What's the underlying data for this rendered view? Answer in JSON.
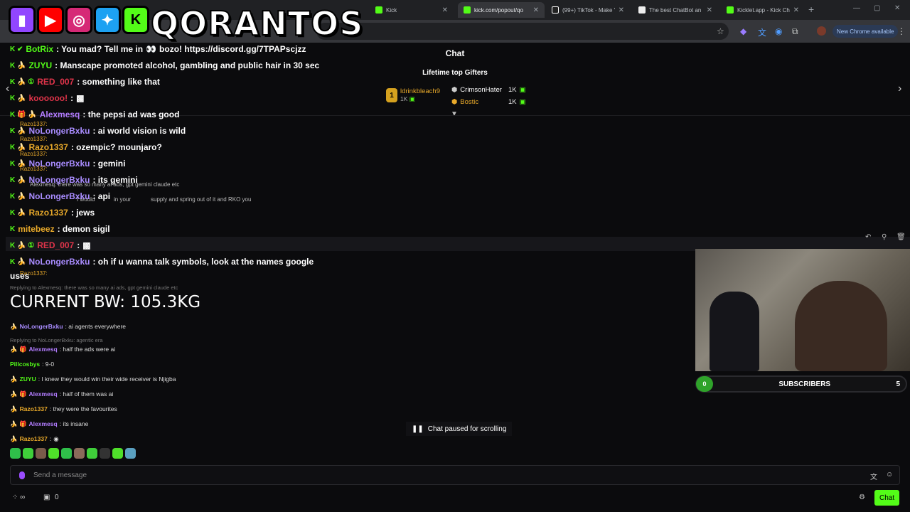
{
  "browser": {
    "tabs": [
      {
        "title": "Kick",
        "fav": "#53fc18"
      },
      {
        "title": "kick.com/popout/qo",
        "fav": "#53fc18",
        "active": true
      },
      {
        "title": "(99+) TikTok - Make Y",
        "fav": "#ffffff"
      },
      {
        "title": "The best ChatBot an",
        "fav": "#eeeeee"
      },
      {
        "title": "Kicklet.app - Kick Ch",
        "fav": "#53fc18"
      }
    ],
    "new_chrome": "New Chrome available"
  },
  "overlay": {
    "brand": "QORANTOS",
    "current_bw": "CURRENT BW: 105.3KG"
  },
  "chat": {
    "header": "Chat",
    "gifters_title": "Lifetime top Gifters",
    "gifters": [
      {
        "rank": "1",
        "name": "ldrinkbleach9",
        "amount": "1K",
        "color": "#e8a92a"
      },
      {
        "name": "CrimsonHater",
        "amount": "1K",
        "color": "#ffffff"
      },
      {
        "name": "Bostic",
        "amount": "1K",
        "color": "#e8a92a"
      }
    ],
    "big_messages": [
      {
        "user": "BotRix",
        "color": "#53fc18",
        "text": ": You mad? Tell me in ",
        "text2": " bozo! https://discord.gg/7TPAPscjzz"
      },
      {
        "user": "ZUYU",
        "color": "#53fc18",
        "text": ": Manscape promoted alcohol, gambling and public hair in 30 sec"
      },
      {
        "user": "RED_007",
        "color": "#e0344a",
        "text": ": something like that"
      },
      {
        "user": "koooooo!",
        "color": "#e0344a",
        "text": ":"
      },
      {
        "user": "Alexmesq",
        "color": "#b27cff",
        "text": ": the pepsi ad was good"
      },
      {
        "user": "NoLongerBxku",
        "color": "#a98cff",
        "text": ": ai world vision is wild"
      },
      {
        "user": "Razo1337",
        "color": "#e8a92a",
        "text": ": ozempic? mounjaro?"
      },
      {
        "user": "NoLongerBxku",
        "color": "#a98cff",
        "text": ": gemini"
      },
      {
        "user": "NoLongerBxku",
        "color": "#a98cff",
        "text": ": its gemini"
      },
      {
        "user": "NoLongerBxku",
        "color": "#a98cff",
        "text": ": api"
      },
      {
        "user": "Razo1337",
        "color": "#e8a92a",
        "text": ": jews"
      },
      {
        "user": "mitebeez",
        "color": "#e8a92a",
        "text": ": demon sigil"
      },
      {
        "user": "RED_007",
        "color": "#e0344a",
        "text": ":"
      },
      {
        "user": "NoLongerBxku",
        "color": "#a98cff",
        "text": ": oh if u wanna talk symbols, look at the names google"
      },
      {
        "user": "",
        "color": "#ffffff",
        "text": "uses"
      }
    ],
    "ghost_lines": {
      "g1": "Razo1337:",
      "g2": "Razo1337:",
      "g3": "Razo1337:",
      "g4": "Razo1337:",
      "g5": "Alexmesq: there was so many ai ads, gpt gemini claude etc",
      "g6": "I would",
      "g7": "in your",
      "g8": "supply and spring out of it and RKO you",
      "g9": "Razo1337:"
    },
    "small_messages": [
      {
        "user": "NoLongerBxku",
        "color": "#a98cff",
        "text": ": ai agents everywhere"
      },
      {
        "user": "Alexmesq",
        "color": "#b27cff",
        "text": ": half the ads were ai"
      },
      {
        "user": "Pillcosbys",
        "color": "#53fc18",
        "text": ": 9-0"
      },
      {
        "user": "ZUYU",
        "color": "#53fc18",
        "text": ": I knew they would win their wide receiver is Njigba"
      },
      {
        "user": "Alexmesq",
        "color": "#b27cff",
        "text": ": half of them was ai"
      },
      {
        "user": "Razo1337",
        "color": "#e8a92a",
        "text": ": they were the favourites"
      },
      {
        "user": "Alexmesq",
        "color": "#b27cff",
        "text": ": its insane"
      },
      {
        "user": "Razo1337",
        "color": "#e8a92a",
        "text": ":"
      }
    ],
    "replies": {
      "r1": "Replying to Alexmesq: there was so many ai ads, gpt gemini claude etc",
      "r2": "Replying to NoLongerBxku: agentic era"
    },
    "paused": "Chat paused for scrolling",
    "placeholder": "Send a message",
    "bottom_count": "0",
    "chat_button": "Chat"
  },
  "subs": {
    "current": "0",
    "label": "SUBSCRIBERS",
    "goal": "5",
    "progress": 0
  }
}
